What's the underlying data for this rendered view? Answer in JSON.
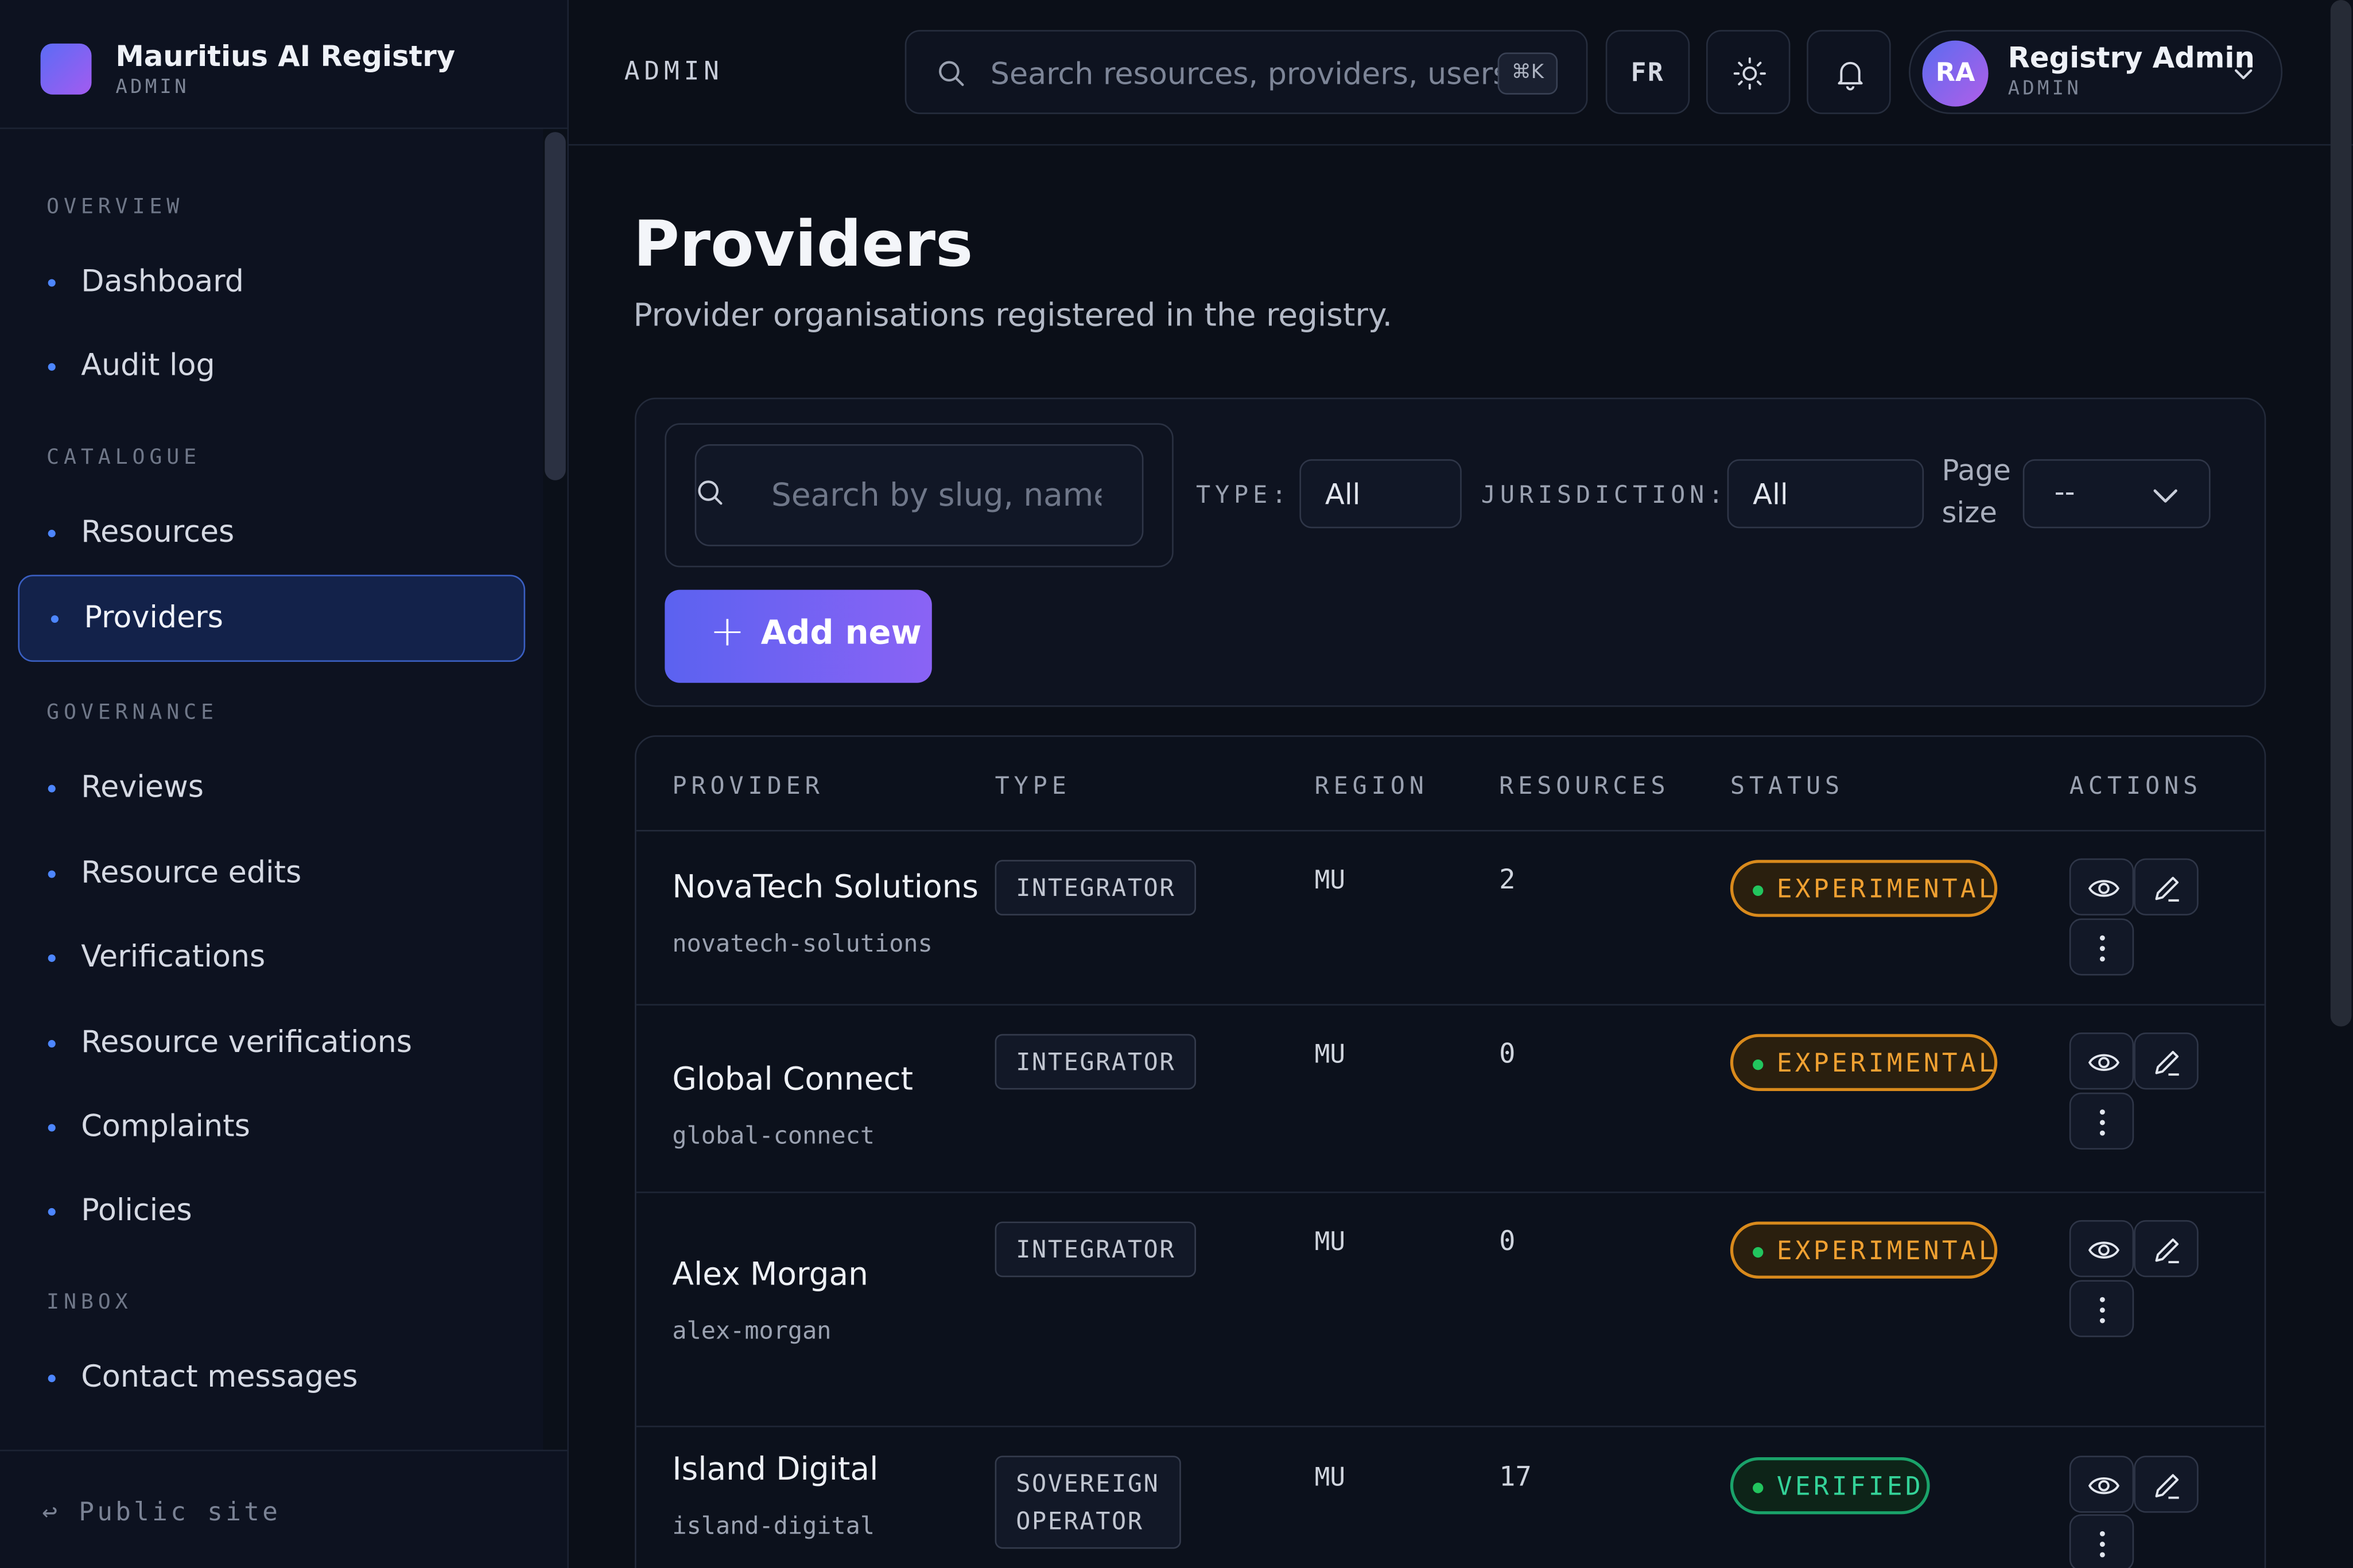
{
  "brand": {
    "name": "Mauritius AI Registry",
    "sub": "ADMIN"
  },
  "sidebar": {
    "sections": [
      {
        "label": "OVERVIEW",
        "items": [
          "Dashboard",
          "Audit log"
        ]
      },
      {
        "label": "CATALOGUE",
        "items": [
          "Resources",
          "Providers"
        ]
      },
      {
        "label": "GOVERNANCE",
        "items": [
          "Reviews",
          "Resource edits",
          "Verifications",
          "Resource verifications",
          "Complaints",
          "Policies"
        ]
      },
      {
        "label": "INBOX",
        "items": [
          "Contact messages"
        ]
      }
    ],
    "active": "Providers",
    "footer": "↩ Public site"
  },
  "topbar": {
    "admin_label": "ADMIN",
    "search_placeholder": "Search resources, providers, users...",
    "shortcut": "⌘K",
    "lang": "FR",
    "user": {
      "initials": "RA",
      "name": "Registry Admin",
      "role": "ADMIN"
    }
  },
  "page": {
    "title": "Providers",
    "subtitle": "Provider organisations registered in the registry."
  },
  "filters": {
    "search_placeholder": "Search by slug, name, ...",
    "type_label": "TYPE:",
    "type_value": "All",
    "jurisdiction_label": "JURISDICTION:",
    "jurisdiction_value": "All",
    "page_size_label_1": "Page",
    "page_size_label_2": "size",
    "page_size_value": "--",
    "add_label": "Add new"
  },
  "table": {
    "columns": [
      "PROVIDER",
      "TYPE",
      "REGION",
      "RESOURCES",
      "STATUS",
      "ACTIONS"
    ],
    "rows": [
      {
        "name": "NovaTech Solutions",
        "slug": "novatech-solutions",
        "type": "INTEGRATOR",
        "region": "MU",
        "resources": "2",
        "status": "EXPERIMENTAL"
      },
      {
        "name": "Global Connect",
        "slug": "global-connect",
        "type": "INTEGRATOR",
        "region": "MU",
        "resources": "0",
        "status": "EXPERIMENTAL"
      },
      {
        "name": "Alex Morgan",
        "slug": "alex-morgan",
        "type": "INTEGRATOR",
        "region": "MU",
        "resources": "0",
        "status": "EXPERIMENTAL"
      },
      {
        "name": "Island Digital",
        "slug": "island-digital",
        "type_line1": "SOVEREIGN",
        "type_line2": "OPERATOR",
        "region": "MU",
        "resources": "17",
        "status": "VERIFIED"
      }
    ]
  },
  "colors": {
    "accent": "#5b62f0",
    "experimental": "#f0a132",
    "verified": "#34d399",
    "active_nav": "#13224a"
  }
}
